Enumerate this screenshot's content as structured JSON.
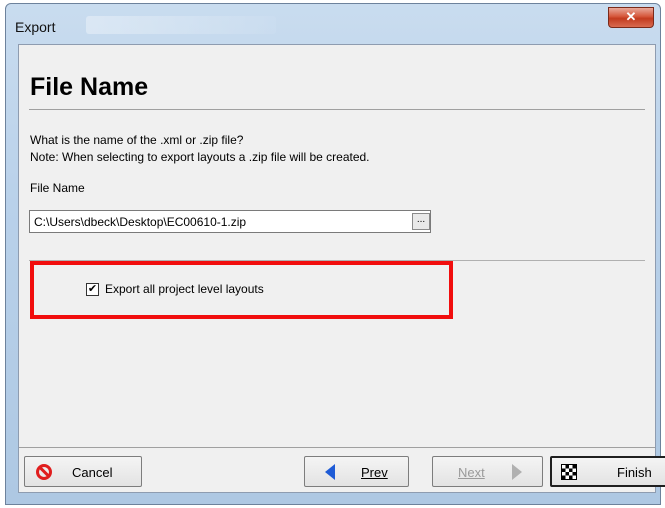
{
  "window": {
    "title": "Export",
    "close_glyph": "✕"
  },
  "page": {
    "heading": "File Name",
    "description_line1": "What is the name of the .xml or .zip file?",
    "description_line2": "Note: When selecting to export layouts a .zip file will be created."
  },
  "file_field": {
    "label": "File Name",
    "value": "C:\\Users\\dbeck\\Desktop\\EC00610-1.zip",
    "browse_label": "..."
  },
  "export_option": {
    "label": "Export all project level layouts",
    "checked": true,
    "check_glyph": "✔",
    "highlight_color": "#f10e0e"
  },
  "footer": {
    "cancel_label": "Cancel",
    "prev_label": "Prev",
    "next_label": "Next",
    "finish_label": "Finish"
  },
  "icons": {
    "cancel": "cancel-icon",
    "prev": "arrow-left-icon",
    "next": "arrow-right-icon",
    "finish": "checkered-flag-icon"
  }
}
